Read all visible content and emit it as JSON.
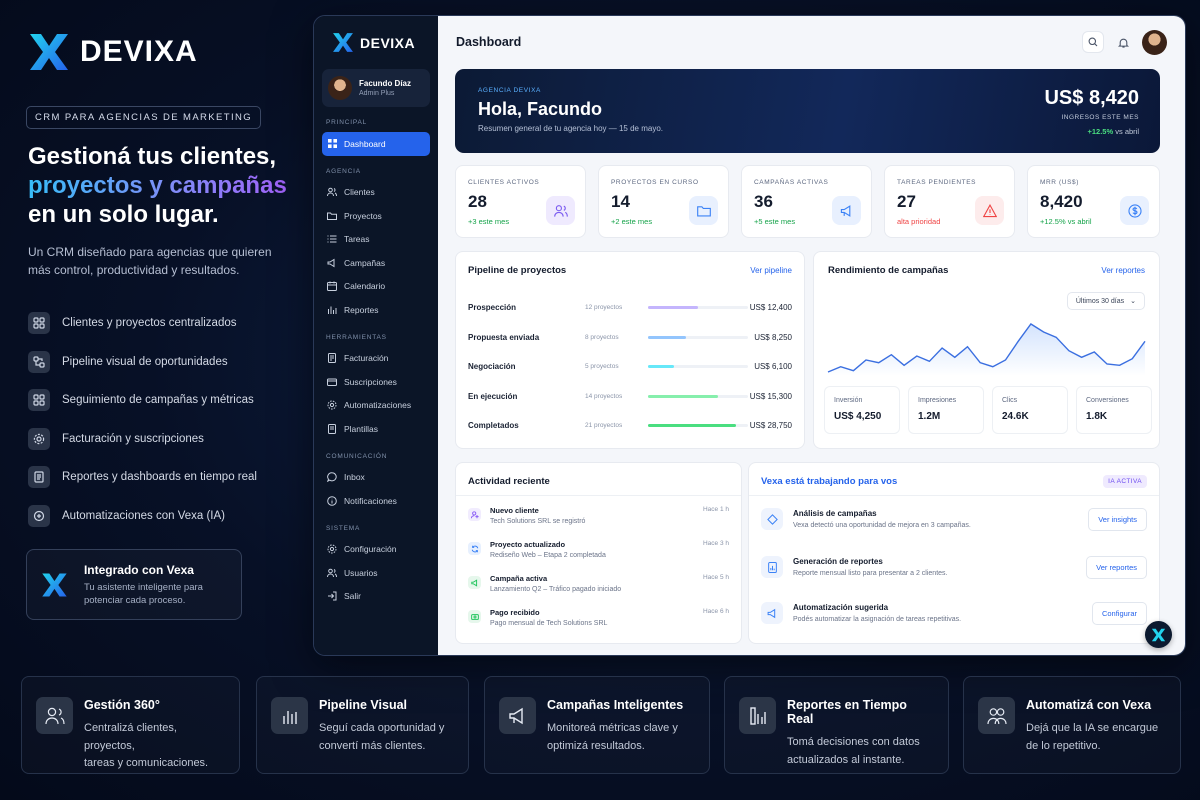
{
  "brand": {
    "name": "DEVIXA"
  },
  "left": {
    "tag": "CRM PARA AGENCIAS DE MARKETING",
    "headline_1": "Gestioná tus clientes,",
    "headline_2": "proyectos y campañas",
    "headline_3": "en un solo lugar.",
    "subtitle": "Un CRM diseñado para agencias que quieren más control, productividad y resultados.",
    "features": [
      {
        "label": "Clientes y proyectos centralizados",
        "icon": "grid-icon"
      },
      {
        "label": "Pipeline visual de oportunidades",
        "icon": "pipeline-icon"
      },
      {
        "label": "Seguimiento de campañas y métricas",
        "icon": "grid-icon"
      },
      {
        "label": "Facturación y suscripciones",
        "icon": "gear-icon"
      },
      {
        "label": "Reportes y dashboards en tiempo real",
        "icon": "document-icon"
      },
      {
        "label": "Automatizaciones con Vexa (IA)",
        "icon": "ai-icon"
      }
    ],
    "vexa_card": {
      "title": "Integrado con Vexa",
      "desc": "Tu asistente inteligente para potenciar cada proceso."
    }
  },
  "sidebar": {
    "user": {
      "name": "Facundo Díaz",
      "role": "Admin Plus"
    },
    "sections": {
      "principal": "PRINCIPAL",
      "agencia": "AGENCIA",
      "herramientas": "HERRAMIENTAS",
      "comunicacion": "COMUNICACIÓN",
      "sistema": "SISTEMA"
    },
    "items": {
      "dashboard": "Dashboard",
      "clientes": "Clientes",
      "proyectos": "Proyectos",
      "tareas": "Tareas",
      "campanas": "Campañas",
      "calendario": "Calendario",
      "reportes": "Reportes",
      "facturacion": "Facturación",
      "suscripciones": "Suscripciones",
      "automatizaciones": "Automatizaciones",
      "plantillas": "Plantillas",
      "inbox": "Inbox",
      "notificaciones": "Notificaciones",
      "configuracion": "Configuración",
      "usuarios": "Usuarios",
      "salir": "Salir"
    }
  },
  "header": {
    "title": "Dashboard"
  },
  "welcome": {
    "agency": "AGENCIA DEVIXA",
    "greeting": "Hola, Facundo",
    "summary": "Resumen general de tu agencia hoy — 15 de mayo.",
    "amount": "US$ 8,420",
    "amount_label": "INGRESOS ESTE MES",
    "change": "+12.5%",
    "change_suffix": "vs abril"
  },
  "stats": [
    {
      "label": "CLIENTES ACTIVOS",
      "value": "28",
      "sub": "+3 este mes",
      "color": "#16a34a",
      "icon": "users-icon"
    },
    {
      "label": "PROYECTOS EN CURSO",
      "value": "14",
      "sub": "+2 este mes",
      "color": "#16a34a",
      "icon": "folder-icon"
    },
    {
      "label": "CAMPAÑAS ACTIVAS",
      "value": "36",
      "sub": "+5 este mes",
      "color": "#16a34a",
      "icon": "megaphone-icon"
    },
    {
      "label": "TAREAS PENDIENTES",
      "value": "27",
      "sub": "alta prioridad",
      "color": "#ef4444",
      "icon": "alert-icon"
    },
    {
      "label": "MRR (US$)",
      "value": "8,420",
      "sub": "+12.5% vs abril",
      "color": "#16a34a",
      "icon": "dollar-icon"
    }
  ],
  "pipeline": {
    "title": "Pipeline de proyectos",
    "action": "Ver pipeline",
    "rows": [
      {
        "stage": "Prospección",
        "count": "12 proyectos",
        "value": "US$ 12,400",
        "fill": 0.5,
        "color": "#c4b5fd"
      },
      {
        "stage": "Propuesta enviada",
        "count": "8 proyectos",
        "value": "US$ 8,250",
        "fill": 0.38,
        "color": "#93c5fd"
      },
      {
        "stage": "Negociación",
        "count": "5 proyectos",
        "value": "US$ 6,100",
        "fill": 0.26,
        "color": "#67e8f9"
      },
      {
        "stage": "En ejecución",
        "count": "14 proyectos",
        "value": "US$ 15,300",
        "fill": 0.7,
        "color": "#86efac"
      },
      {
        "stage": "Completados",
        "count": "21 proyectos",
        "value": "US$ 28,750",
        "fill": 0.88,
        "color": "#4ade80"
      }
    ]
  },
  "performance": {
    "title": "Rendimiento de campañas",
    "action": "Ver reportes",
    "range": "Últimos 30 días",
    "series": [
      22,
      26,
      23,
      31,
      29,
      35,
      27,
      34,
      30,
      40,
      33,
      41,
      29,
      26,
      31,
      45,
      58,
      52,
      48,
      38,
      33,
      37,
      28,
      27,
      32,
      45
    ],
    "metrics": [
      {
        "label": "Inversión",
        "value": "US$ 4,250"
      },
      {
        "label": "Impresiones",
        "value": "1.2M"
      },
      {
        "label": "Clics",
        "value": "24.6K"
      },
      {
        "label": "Conversiones",
        "value": "1.8K"
      }
    ]
  },
  "activity": {
    "title": "Actividad reciente",
    "items": [
      {
        "title": "Nuevo cliente",
        "desc": "Tech Solutions SRL se registró",
        "time": "Hace 1 h",
        "color": "#8b5cf6",
        "bg": "#f1ecfe",
        "icon": "user-plus-icon"
      },
      {
        "title": "Proyecto actualizado",
        "desc": "Rediseño Web – Etapa 2 completada",
        "time": "Hace 3 h",
        "color": "#3b82f6",
        "bg": "#e7f0fe",
        "icon": "refresh-icon"
      },
      {
        "title": "Campaña activa",
        "desc": "Lanzamiento Q2 – Tráfico pagado iniciado",
        "time": "Hace 5 h",
        "color": "#22c55e",
        "bg": "#e6f7ec",
        "icon": "megaphone-icon"
      },
      {
        "title": "Pago recibido",
        "desc": "Pago mensual de Tech Solutions SRL",
        "time": "Hace 6 h",
        "color": "#22c55e",
        "bg": "#e6f7ec",
        "icon": "dollar-icon"
      }
    ]
  },
  "vexa": {
    "title": "Vexa está trabajando para vos",
    "badge": "IA ACTIVA",
    "items": [
      {
        "title": "Análisis de campañas",
        "desc": "Vexa detectó una oportunidad de mejora en 3 campañas.",
        "button": "Ver insights",
        "icon": "diamond-icon"
      },
      {
        "title": "Generación de reportes",
        "desc": "Reporte mensual listo para presentar a 2 clientes.",
        "button": "Ver reportes",
        "icon": "chart-icon"
      },
      {
        "title": "Automatización sugerida",
        "desc": "Podés automatizar la asignación de tareas repetitivas.",
        "button": "Configurar",
        "icon": "megaphone-icon"
      }
    ]
  },
  "bottom": [
    {
      "title": "Gestión 360°",
      "l1": "Centralizá clientes, proyectos,",
      "l2": "tareas y comunicaciones.",
      "icon": "users-icon"
    },
    {
      "title": "Pipeline Visual",
      "l1": "Seguí cada oportunidad y",
      "l2": "convertí más clientes.",
      "icon": "bar-chart-icon"
    },
    {
      "title": "Campañas Inteligentes",
      "l1": "Monitoreá métricas clave y",
      "l2": "optimizá resultados.",
      "icon": "megaphone-icon"
    },
    {
      "title": "Reportes en Tiempo Real",
      "l1": "Tomá decisiones con datos",
      "l2": "actualizados al instante.",
      "icon": "report-icon"
    },
    {
      "title": "Automatizá con Vexa",
      "l1": "Dejá que la IA se encargue",
      "l2": "de lo repetitivo.",
      "icon": "users-icon"
    }
  ]
}
